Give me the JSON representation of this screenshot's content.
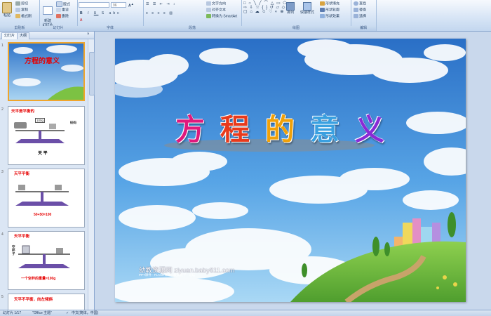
{
  "ribbon": {
    "clipboard": {
      "label": "剪贴板",
      "paste": "粘贴",
      "cut": "剪切",
      "copy": "复制",
      "format_painter": "格式刷"
    },
    "slides": {
      "label": "幻灯片",
      "new_slide": "新建\n幻灯片",
      "layout": "版式",
      "reset": "重设",
      "delete": "删除"
    },
    "font": {
      "label": "字体",
      "size": "96"
    },
    "paragraph": {
      "label": "段落",
      "text_direction": "文字方向",
      "align_text": "对齐文本",
      "smartart": "转换为 SmartArt"
    },
    "drawing": {
      "label": "绘图",
      "arrange": "排列",
      "quick_styles": "快速样式",
      "shape_fill": "形状填充",
      "shape_outline": "形状轮廓",
      "shape_effects": "形状效果"
    },
    "editing": {
      "label": "编辑",
      "find": "查找",
      "replace": "替换",
      "select": "选择"
    }
  },
  "pane": {
    "tabs": [
      "幻灯片",
      "大纲"
    ],
    "thumbs": [
      {
        "num": "1",
        "title": "方程的意义"
      },
      {
        "num": "2",
        "title": "天平是平衡的",
        "weight": "100g",
        "label_weight": "砝码",
        "caption": "天 平"
      },
      {
        "num": "3",
        "title": "天平平衡",
        "caption": "50+50=100"
      },
      {
        "num": "4",
        "title": "天平平衡",
        "side": "空杯子",
        "caption": "一个空杯的重量=100g"
      },
      {
        "num": "5",
        "title": "天平不平衡，向左倾斜"
      }
    ]
  },
  "slide": {
    "title_chars": [
      "方",
      "程",
      "的",
      "意",
      "义"
    ],
    "title_colors": [
      "#e0197d",
      "#e83a1c",
      "#f0a10a",
      "#3aa0e0",
      "#8a2bd6"
    ],
    "footer_line1": "幼教资源网 ziyuan.baby611.com",
    "footer_line2": "PPT课件 · FLASH课件 · 教案教学 · 论坛"
  },
  "status": {
    "slide_info": "幻灯片 1/17",
    "theme": "\"Office 主题\"",
    "language": "中文(简体，中国)"
  }
}
